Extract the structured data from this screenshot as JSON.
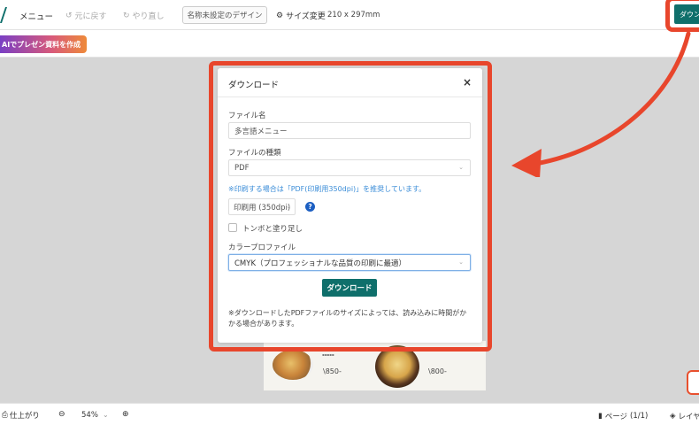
{
  "toolbar": {
    "menu_label": "メニュー",
    "undo_label": "元に戻す",
    "redo_label": "やり直し",
    "design_name": "名称未設定のデザイン",
    "size_change_label": "サイズ変更",
    "size_value": "210 x 297mm",
    "download_label": "ダウン"
  },
  "subbar": {
    "ai_button_label": "AIでプレゼン資料を作成"
  },
  "preview": {
    "price1": "\\850-",
    "price2": "\\800-"
  },
  "modal": {
    "title": "ダウンロード",
    "close_label": "×",
    "file_name_label": "ファイル名",
    "file_name_value": "多言語メニュー",
    "file_type_label": "ファイルの種類",
    "file_type_value": "PDF",
    "print_note": "※印刷する場合は「PDF(印刷用350dpi)」を推奨しています。",
    "print_quality_value": "印刷用 (350dpi)",
    "help_label": "?",
    "bleed_label": "トンボと塗り足し",
    "color_profile_label": "カラープロファイル",
    "color_profile_value": "CMYK（プロフェッショナルな品質の印刷に最適）",
    "download_button_label": "ダウンロード",
    "footnote": "※ダウンロードしたPDFファイルのサイズによっては、読み込みに時間がかかる場合があります。"
  },
  "bottombar": {
    "finish_label": "仕上がり",
    "zoom_value": "54%",
    "pages_label": "ページ",
    "pages_count": "(1/1)",
    "layers_label": "レイヤ"
  },
  "colors": {
    "accent": "#0f6f6b",
    "annotation": "#e8462c",
    "note_blue": "#3d8ed8"
  }
}
